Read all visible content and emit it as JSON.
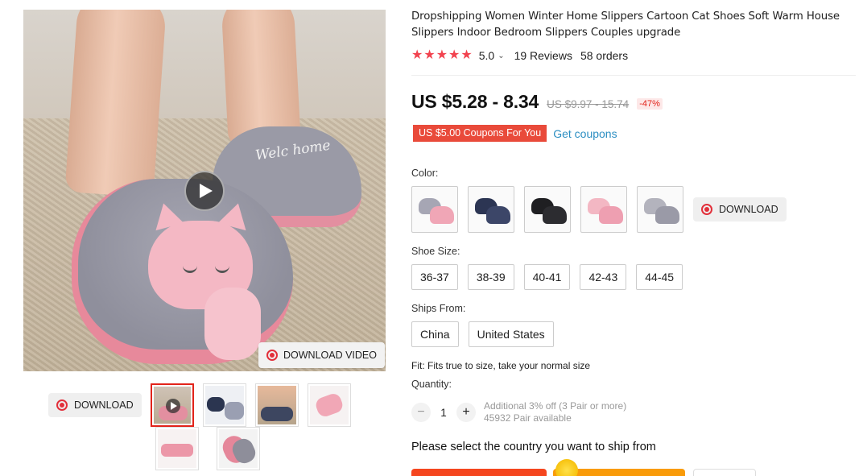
{
  "product": {
    "title": "Dropshipping Women Winter Home Slippers Cartoon Cat Shoes Soft Warm House Slippers Indoor Bedroom Slippers Couples upgrade",
    "rating": {
      "value": "5.0",
      "stars": 5,
      "reviews": "19 Reviews",
      "orders": "58 orders"
    },
    "price": "US $5.28 - 8.34",
    "original_price": "US $9.97 - 15.74",
    "discount": "-47%",
    "coupon": {
      "badge": "US $5.00 Coupons For You",
      "link": "Get coupons"
    },
    "back_slipper_text": "Welc home",
    "accent_color": "#f2434f"
  },
  "gallery": {
    "video_button": "DOWNLOAD VIDEO",
    "download_button": "DOWNLOAD",
    "thumbnail_count": 6,
    "active_thumbnail": 0
  },
  "options": {
    "color_label": "Color:",
    "colors": [
      {
        "name": "grey-pink"
      },
      {
        "name": "navy"
      },
      {
        "name": "black"
      },
      {
        "name": "pink"
      },
      {
        "name": "grey"
      }
    ],
    "color_download": "DOWNLOAD",
    "size_label": "Shoe Size:",
    "sizes": [
      "36-37",
      "38-39",
      "40-41",
      "42-43",
      "44-45"
    ],
    "ships_label": "Ships From:",
    "ships": [
      "China",
      "United States"
    ],
    "fit": "Fit: Fits true to size, take your normal size"
  },
  "quantity": {
    "label": "Quantity:",
    "minus": "−",
    "plus": "+",
    "value": "1",
    "offer": "Additional 3% off (3 Pair or more)",
    "available": "45932 Pair available"
  },
  "shipping": {
    "prompt": "Please select the country you want to ship from"
  }
}
